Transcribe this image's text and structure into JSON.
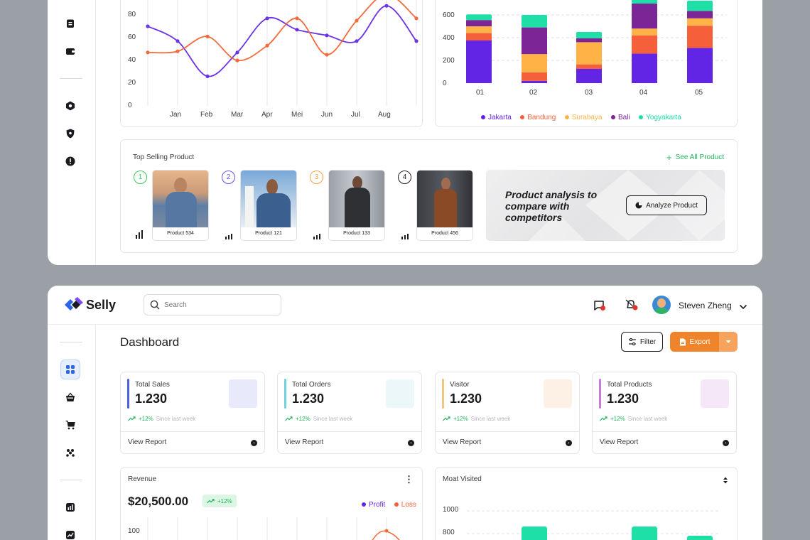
{
  "sales_chart": {
    "y_ticks": [
      "80",
      "60",
      "40",
      "20",
      "0"
    ],
    "x_ticks": [
      "Jan",
      "Feb",
      "Mar",
      "Apr",
      "Mei",
      "Jun",
      "Jul",
      "Aug"
    ]
  },
  "stacked_chart": {
    "y_ticks": [
      "600",
      "400",
      "200",
      "0"
    ],
    "x_ticks": [
      "01",
      "02",
      "03",
      "04",
      "05"
    ],
    "legend": [
      {
        "name": "Jakarta",
        "color": "#6225e6"
      },
      {
        "name": "Bandung",
        "color": "#f5603a"
      },
      {
        "name": "Surabaya",
        "color": "#ffb347"
      },
      {
        "name": "Bali",
        "color": "#7b2596"
      },
      {
        "name": "Yogyakarta",
        "color": "#1ee0a6"
      }
    ]
  },
  "top_selling": {
    "title": "Top Selling Product",
    "see_all": "See All Product",
    "products": [
      {
        "rank": "1",
        "name": "Product 534",
        "ring": "#34c759"
      },
      {
        "rank": "2",
        "name": "Product 121",
        "ring": "#6a4ce8"
      },
      {
        "rank": "3",
        "name": "Product 133",
        "ring": "#f5a04a"
      },
      {
        "rank": "4",
        "name": "Product 456",
        "ring": "#1b1b1f"
      }
    ],
    "banner_text": "Product analysis to compare with competitors",
    "analyze_button": "Analyze Product"
  },
  "header": {
    "brand": "Selly",
    "search_placeholder": "Search",
    "user_name": "Steven Zheng"
  },
  "dashboard": {
    "title": "Dashboard",
    "filter_label": "Filter",
    "export_label": "Export",
    "stats": [
      {
        "title": "Total Sales",
        "value": "1.230",
        "pct": "+12%",
        "since": "Since last week",
        "link": "View Report",
        "accent": "#4c63e0",
        "square": "#e8eafb"
      },
      {
        "title": "Total Orders",
        "value": "1.230",
        "pct": "+12%",
        "since": "Since last week",
        "link": "View Report",
        "accent": "#6ed3de",
        "square": "#ecf7f9"
      },
      {
        "title": "Visitor",
        "value": "1.230",
        "pct": "+12%",
        "since": "Since last week",
        "link": "View Report",
        "accent": "#f0c580",
        "square": "#fdf1e6"
      },
      {
        "title": "Total Products",
        "value": "1.230",
        "pct": "+12%",
        "since": "Since last week",
        "link": "View Report",
        "accent": "#c87dd8",
        "square": "#f6e7f8"
      }
    ],
    "revenue": {
      "title": "Revenue",
      "amount": "$20,500.00",
      "badge": "+12%",
      "legend_profit": "Profit",
      "legend_loss": "Loss",
      "y_top": "100"
    },
    "visited": {
      "title": "Moat Visited",
      "y_ticks": [
        "1000",
        "800"
      ]
    }
  },
  "chart_data": [
    {
      "type": "line",
      "x": [
        "Jan",
        "Feb",
        "Mar",
        "Apr",
        "Mei",
        "Jun",
        "Jul",
        "Aug"
      ],
      "ylim": [
        0,
        80
      ],
      "series": [
        {
          "color": "#6a33e6",
          "values": [
            70,
            57,
            26,
            47,
            77,
            67,
            62,
            57,
            88,
            57
          ]
        },
        {
          "color": "#f26b3c",
          "values": [
            47,
            48,
            61,
            40,
            53,
            77,
            45,
            75,
            98,
            77
          ]
        }
      ]
    },
    {
      "type": "bar",
      "stacked": true,
      "categories": [
        "01",
        "02",
        "03",
        "04",
        "05"
      ],
      "ylim": [
        0,
        600
      ],
      "series": [
        {
          "name": "Jakarta",
          "values": [
            375,
            20,
            125,
            260,
            310
          ]
        },
        {
          "name": "Bandung",
          "values": [
            65,
            75,
            40,
            160,
            195
          ]
        },
        {
          "name": "Surabaya",
          "values": [
            60,
            160,
            195,
            60,
            65
          ]
        },
        {
          "name": "Bali",
          "values": [
            55,
            235,
            35,
            220,
            65
          ]
        },
        {
          "name": "Yogyakarta",
          "values": [
            50,
            110,
            55,
            40,
            90
          ]
        }
      ]
    }
  ]
}
